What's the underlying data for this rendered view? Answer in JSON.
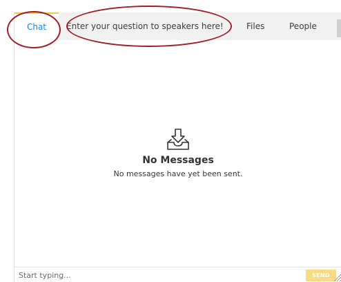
{
  "tabs": {
    "chat": "Chat",
    "question": "Enter your question to speakers here!",
    "files": "Files",
    "people": "People"
  },
  "empty_state": {
    "icon": "inbox-download-icon",
    "title": "No Messages",
    "subtitle": "No messages have yet been sent."
  },
  "composer": {
    "placeholder": "Start typing...",
    "value": "",
    "send_label": "SEND"
  },
  "colors": {
    "active_tab_text": "#1a86d6",
    "active_tab_indicator": "#f2c744",
    "send_button": "#f7dc85",
    "annotation": "#a31d22"
  }
}
